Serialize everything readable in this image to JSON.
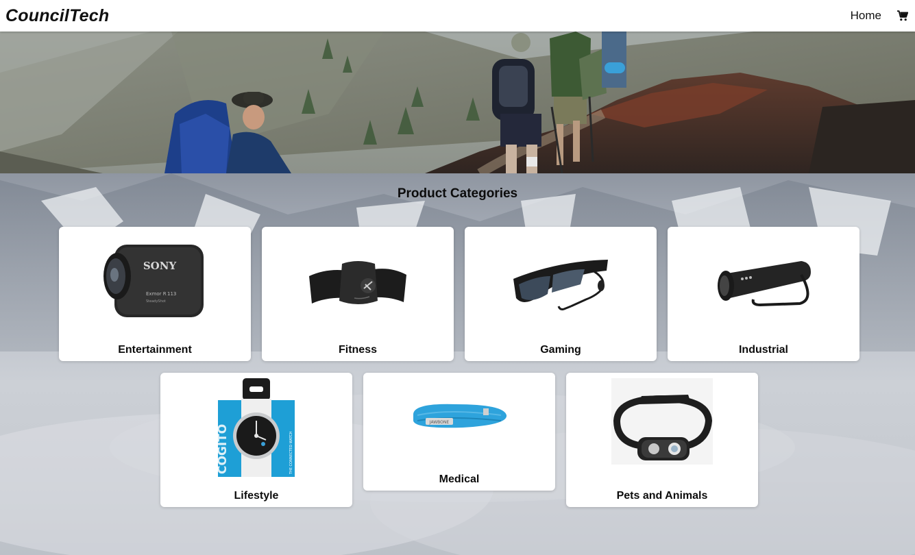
{
  "navbar": {
    "brand": "CouncilTech",
    "home_label": "Home",
    "cart_icon": "shopping-cart-icon"
  },
  "hero": {
    "image": "hikers-on-mountain-ridge"
  },
  "main": {
    "title": "Product Categories",
    "categories": [
      {
        "label": "Entertainment",
        "image": "action-camera"
      },
      {
        "label": "Fitness",
        "image": "heart-rate-chest-strap"
      },
      {
        "label": "Gaming",
        "image": "video-glasses"
      },
      {
        "label": "Industrial",
        "image": "flashlight"
      },
      {
        "label": "Lifestyle",
        "image": "smart-watch"
      },
      {
        "label": "Medical",
        "image": "fitness-wristband"
      },
      {
        "label": "Pets and Animals",
        "image": "headlamp"
      }
    ],
    "product_text": {
      "camera_brand": "SONY",
      "camera_model": "Exmor R",
      "camera_model_suffix": "113",
      "camera_sub": "SteadyShot",
      "watch_brand": "COGITO",
      "watch_tagline": "THE CONNECTED WATCH",
      "band_brand": "JAWBONE"
    }
  },
  "colors": {
    "navbar_bg": "#ffffff",
    "card_bg": "#ffffff",
    "text": "#0c0c0c",
    "accent_band": "#2ea3dc",
    "accent_watch_box": "#1e9fd6"
  }
}
